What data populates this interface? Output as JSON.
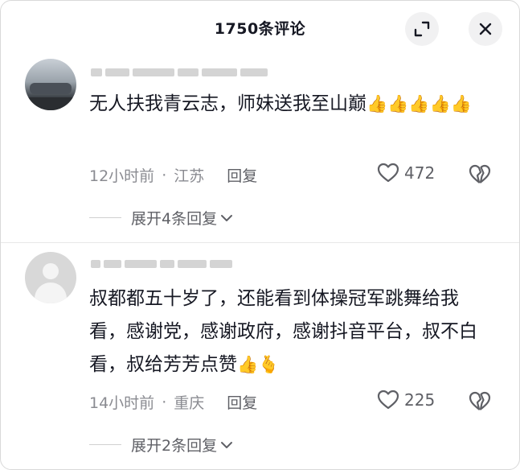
{
  "header": {
    "title": "1750条评论"
  },
  "comments": [
    {
      "text": "无人扶我青云志，师妹送我至山巅",
      "emoji": "👍👍👍👍👍",
      "time": "12小时前",
      "sep": "·",
      "location": "江苏",
      "reply_label": "回复",
      "like_count": "472",
      "expand_label": "展开4条回复"
    },
    {
      "text": "叔都都五十岁了，还能看到体操冠军跳舞给我看，感谢党，感谢政府，感谢抖音平台，叔不白看，叔给芳芳点赞",
      "emoji": "👍🫰",
      "time": "14小时前",
      "sep": "·",
      "location": "重庆",
      "reply_label": "回复",
      "like_count": "225",
      "expand_label": "展开2条回复"
    }
  ],
  "icons": {
    "expand": "expand-icon",
    "close": "close-icon",
    "like": "heart-icon",
    "dislike": "broken-heart-icon",
    "chevron": "chevron-down-icon"
  }
}
